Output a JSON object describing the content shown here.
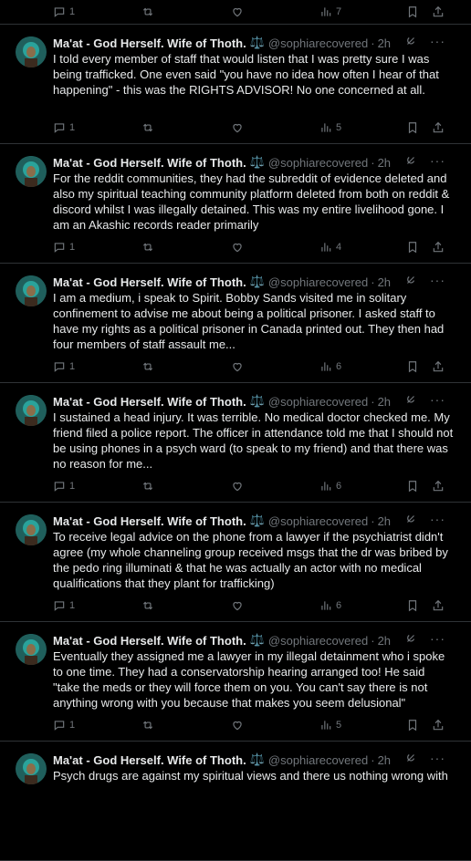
{
  "top": {
    "reply_count": "1",
    "views": "7"
  },
  "tweets": [
    {
      "name": "Ma'at - God Herself. Wife of Thoth.",
      "badge": "⚖️",
      "handle": "@sophiarecovered",
      "time": "2h",
      "text": "I told every member of staff that would listen that I was pretty sure I was being trafficked. One even said \"you have no idea how often I hear of that happening\" - this was the RIGHTS ADVISOR! No one concerned at all.",
      "replies": "1",
      "views": "5"
    },
    {
      "name": "Ma'at - God Herself. Wife of Thoth.",
      "badge": "⚖️",
      "handle": "@sophiarecovered",
      "time": "2h",
      "text": "For the reddit communities,  they had the subreddit of evidence deleted and also my spiritual teaching community platform deleted from both on reddit & discord whilst I was illegally detained. This was my entire livelihood gone. I am an Akashic records reader primarily",
      "replies": "1",
      "views": "4"
    },
    {
      "name": "Ma'at - God Herself. Wife of Thoth.",
      "badge": "⚖️",
      "handle": "@sophiarecovered",
      "time": "2h",
      "text": "I am a medium, i speak to Spirit. Bobby Sands visited me in solitary confinement to advise me about being a political prisoner.  I asked staff to have my rights as a political prisoner in Canada printed out. They then had four members of staff assault me...",
      "replies": "1",
      "views": "6"
    },
    {
      "name": "Ma'at - God Herself. Wife of Thoth.",
      "badge": "⚖️",
      "handle": "@sophiarecovered",
      "time": "2h",
      "text": "I sustained a head injury.  It was terrible.  No medical doctor checked me. My friend filed a police report.  The officer in attendance told me that I should not be using phones in a psych ward (to speak to my friend) and that there was no reason for me...",
      "replies": "1",
      "views": "6"
    },
    {
      "name": "Ma'at - God Herself. Wife of Thoth.",
      "badge": "⚖️",
      "handle": "@sophiarecovered",
      "time": "2h",
      "text": "To receive legal advice on the phone from a lawyer if the psychiatrist didn't agree (my whole channeling group received msgs that the dr was bribed by the pedo ring illuminati & that he was actually an actor with no medical qualifications that they plant for trafficking)",
      "replies": "1",
      "views": "6"
    },
    {
      "name": "Ma'at - God Herself. Wife of Thoth.",
      "badge": "⚖️",
      "handle": "@sophiarecovered",
      "time": "2h",
      "text": "Eventually they assigned me a lawyer in my illegal detainment who i spoke to one time. They had a conservatorship hearing arranged too! He said \"take the meds or they will force them on you. You can't say there is not anything wrong with you because that makes you seem delusional\"",
      "replies": "1",
      "views": "5"
    },
    {
      "name": "Ma'at - God Herself. Wife of Thoth.",
      "badge": "⚖️",
      "handle": "@sophiarecovered",
      "time": "2h",
      "text": "Psych drugs are against my spiritual views and there us nothing wrong with",
      "replies": "",
      "views": ""
    }
  ],
  "icons": {
    "reply": "reply-icon",
    "retweet": "retweet-icon",
    "like": "heart-icon",
    "views": "views-icon",
    "bookmark": "bookmark-icon",
    "share": "share-icon",
    "grok": "grok-icon",
    "more": "more-icon"
  },
  "colors": {
    "background": "#000000",
    "text": "#e7e9ea",
    "muted": "#71767b",
    "divider": "#2f3336"
  }
}
